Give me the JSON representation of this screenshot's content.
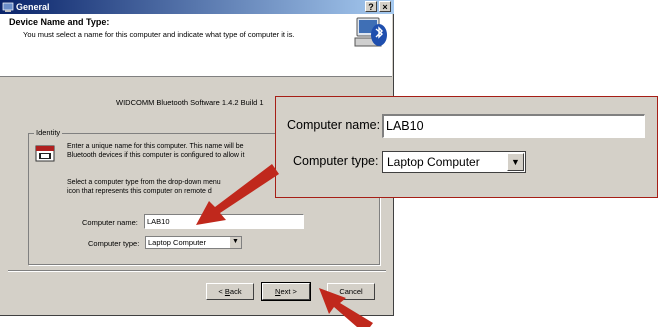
{
  "window": {
    "title": "General",
    "help_btn": "?",
    "close_btn": "×"
  },
  "header": {
    "title": "Device Name and Type:",
    "subtitle": "You must select a name for this computer and indicate what type of computer it is."
  },
  "version_text": "WIDCOMM Bluetooth Software 1.4.2 Build 1",
  "identity": {
    "group_label": "Identity",
    "paragraph1": [
      "Enter a unique name for this computer.  This name will be",
      "Bluetooth devices if this computer is configured to allow it"
    ],
    "paragraph2": [
      "Select a computer type from the drop-down menu",
      "icon that represents this computer on remote d"
    ],
    "computer_name_label": "Computer name:",
    "computer_name_value": "LAB10",
    "computer_type_label": "Computer type:",
    "computer_type_value": "Laptop Computer"
  },
  "buttons": {
    "back": "< Back",
    "next": "Next >",
    "cancel": "Cancel"
  },
  "zoom": {
    "computer_name_label": "Computer name:",
    "computer_name_value": "LAB10",
    "computer_type_label": "Computer type:",
    "computer_type_value": "Laptop Computer"
  },
  "icons": {
    "title": "bluetooth-app-icon",
    "header": "bluetooth-computer-icon",
    "identity": "calendar-icon",
    "dropdown": "chevron-down-icon"
  },
  "colors": {
    "titlebar_start": "#0a246a",
    "titlebar_end": "#a6caf0",
    "dialog_bg": "#d4d0c8",
    "arrow": "#c0281c"
  }
}
